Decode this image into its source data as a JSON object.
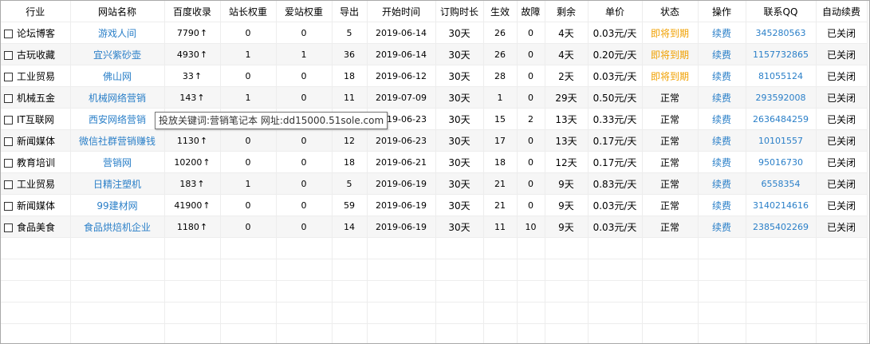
{
  "table": {
    "headers": [
      "行业",
      "网站名称",
      "百度收录",
      "站长权重",
      "爱站权重",
      "导出",
      "开始时间",
      "订购时长",
      "生效",
      "故障",
      "剩余",
      "单价",
      "状态",
      "操作",
      "联系QQ",
      "自动续费"
    ],
    "rows": [
      {
        "industry": "论坛博客",
        "site": "游戏人间",
        "baidu": "7790",
        "zz_weight": "0",
        "az_weight": "0",
        "export": "5",
        "start": "2019-06-14",
        "duration": "30天",
        "effective": "26",
        "fault": "0",
        "remaining": "4天",
        "price": "0.03元/天",
        "status": "即将到期",
        "status_type": "warn",
        "action": "续费",
        "qq": "345280563",
        "autorenew": "已关闭"
      },
      {
        "industry": "古玩收藏",
        "site": "宜兴紫砂壶",
        "baidu": "4930",
        "zz_weight": "1",
        "az_weight": "1",
        "export": "36",
        "start": "2019-06-14",
        "duration": "30天",
        "effective": "26",
        "fault": "0",
        "remaining": "4天",
        "price": "0.20元/天",
        "status": "即将到期",
        "status_type": "warn",
        "action": "续费",
        "qq": "1157732865",
        "autorenew": "已关闭"
      },
      {
        "industry": "工业贸易",
        "site": "佛山网",
        "baidu": "33",
        "zz_weight": "0",
        "az_weight": "0",
        "export": "18",
        "start": "2019-06-12",
        "duration": "30天",
        "effective": "28",
        "fault": "0",
        "remaining": "2天",
        "price": "0.03元/天",
        "status": "即将到期",
        "status_type": "warn",
        "action": "续费",
        "qq": "81055124",
        "autorenew": "已关闭"
      },
      {
        "industry": "机械五金",
        "site": "机械网络营销",
        "baidu": "143",
        "zz_weight": "1",
        "az_weight": "0",
        "export": "11",
        "start": "2019-07-09",
        "duration": "30天",
        "effective": "1",
        "fault": "0",
        "remaining": "29天",
        "price": "0.50元/天",
        "status": "正常",
        "status_type": "ok",
        "action": "续费",
        "qq": "293592008",
        "autorenew": "已关闭"
      },
      {
        "industry": "IT互联网",
        "site": "西安网络营销",
        "baidu": "",
        "zz_weight": "",
        "az_weight": "",
        "export": "",
        "start": "2019-06-23",
        "duration": "30天",
        "effective": "15",
        "fault": "2",
        "remaining": "13天",
        "price": "0.33元/天",
        "status": "正常",
        "status_type": "ok",
        "action": "续费",
        "qq": "2636484259",
        "autorenew": "已关闭"
      },
      {
        "industry": "新闻媒体",
        "site": "微信社群营销赚钱",
        "baidu": "1130",
        "zz_weight": "0",
        "az_weight": "0",
        "export": "12",
        "start": "2019-06-23",
        "duration": "30天",
        "effective": "17",
        "fault": "0",
        "remaining": "13天",
        "price": "0.17元/天",
        "status": "正常",
        "status_type": "ok",
        "action": "续费",
        "qq": "10101557",
        "autorenew": "已关闭"
      },
      {
        "industry": "教育培训",
        "site": "营销网",
        "baidu": "10200",
        "zz_weight": "0",
        "az_weight": "0",
        "export": "18",
        "start": "2019-06-21",
        "duration": "30天",
        "effective": "18",
        "fault": "0",
        "remaining": "12天",
        "price": "0.17元/天",
        "status": "正常",
        "status_type": "ok",
        "action": "续费",
        "qq": "95016730",
        "autorenew": "已关闭"
      },
      {
        "industry": "工业贸易",
        "site": "日精注塑机",
        "baidu": "183",
        "zz_weight": "1",
        "az_weight": "0",
        "export": "5",
        "start": "2019-06-19",
        "duration": "30天",
        "effective": "21",
        "fault": "0",
        "remaining": "9天",
        "price": "0.83元/天",
        "status": "正常",
        "status_type": "ok",
        "action": "续费",
        "qq": "6558354",
        "autorenew": "已关闭"
      },
      {
        "industry": "新闻媒体",
        "site": "99建材网",
        "baidu": "41900",
        "zz_weight": "0",
        "az_weight": "0",
        "export": "59",
        "start": "2019-06-19",
        "duration": "30天",
        "effective": "21",
        "fault": "0",
        "remaining": "9天",
        "price": "0.03元/天",
        "status": "正常",
        "status_type": "ok",
        "action": "续费",
        "qq": "3140214616",
        "autorenew": "已关闭"
      },
      {
        "industry": "食品美食",
        "site": "食品烘焙机企业",
        "baidu": "1180",
        "zz_weight": "0",
        "az_weight": "0",
        "export": "14",
        "start": "2019-06-19",
        "duration": "30天",
        "effective": "11",
        "fault": "10",
        "remaining": "9天",
        "price": "0.03元/天",
        "status": "正常",
        "status_type": "ok",
        "action": "续费",
        "qq": "2385402269",
        "autorenew": "已关闭"
      }
    ]
  },
  "tooltip": {
    "text": "投放关键词:营销笔记本  网址:dd15000.51sole.com"
  },
  "icons": {
    "baidu_arrow": "up-arrow-icon",
    "row_checkbox": "checkbox-icon"
  },
  "colors": {
    "link": "#2a7fc8",
    "warn": "#f0a000"
  }
}
